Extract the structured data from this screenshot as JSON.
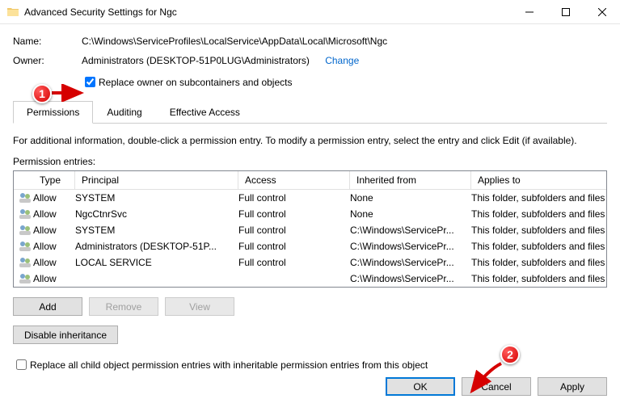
{
  "window": {
    "title": "Advanced Security Settings for Ngc"
  },
  "fields": {
    "name_label": "Name:",
    "name_value": "C:\\Windows\\ServiceProfiles\\LocalService\\AppData\\Local\\Microsoft\\Ngc",
    "owner_label": "Owner:",
    "owner_value": "Administrators (DESKTOP-51P0LUG\\Administrators)",
    "change_link": "Change",
    "replace_owner_label": "Replace owner on subcontainers and objects"
  },
  "tabs": {
    "permissions": "Permissions",
    "auditing": "Auditing",
    "effective_access": "Effective Access"
  },
  "instructions": "For additional information, double-click a permission entry. To modify a permission entry, select the entry and click Edit (if available).",
  "section_label": "Permission entries:",
  "table": {
    "headers": {
      "type": "Type",
      "principal": "Principal",
      "access": "Access",
      "inherited": "Inherited from",
      "applies": "Applies to"
    },
    "rows": [
      {
        "type": "Allow",
        "principal": "SYSTEM",
        "access": "Full control",
        "inherited": "None",
        "applies": "This folder, subfolders and files"
      },
      {
        "type": "Allow",
        "principal": "NgcCtnrSvc",
        "access": "Full control",
        "inherited": "None",
        "applies": "This folder, subfolders and files"
      },
      {
        "type": "Allow",
        "principal": "SYSTEM",
        "access": "Full control",
        "inherited": "C:\\Windows\\ServicePr...",
        "applies": "This folder, subfolders and files"
      },
      {
        "type": "Allow",
        "principal": "Administrators (DESKTOP-51P...",
        "access": "Full control",
        "inherited": "C:\\Windows\\ServicePr...",
        "applies": "This folder, subfolders and files"
      },
      {
        "type": "Allow",
        "principal": "LOCAL SERVICE",
        "access": "Full control",
        "inherited": "C:\\Windows\\ServicePr...",
        "applies": "This folder, subfolders and files"
      },
      {
        "type": "Allow",
        "principal": " ",
        "access": " ",
        "inherited": "C:\\Windows\\ServicePr...",
        "applies": "This folder, subfolders and files",
        "blurred": true
      }
    ]
  },
  "buttons": {
    "add": "Add",
    "remove": "Remove",
    "view": "View",
    "disable_inherit": "Disable inheritance",
    "replace_all": "Replace all child object permission entries with inheritable permission entries from this object",
    "ok": "OK",
    "cancel": "Cancel",
    "apply": "Apply"
  },
  "annotations": {
    "badge1": "1",
    "badge2": "2"
  }
}
